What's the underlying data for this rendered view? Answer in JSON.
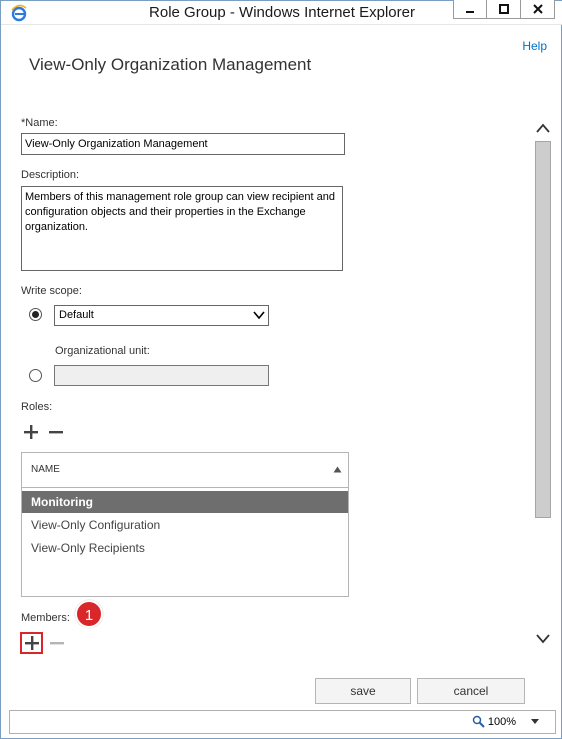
{
  "window": {
    "title": "Role Group - Windows Internet Explorer",
    "controls": [
      "minimize",
      "maximize",
      "close"
    ]
  },
  "help_link": "Help",
  "page_title": "View-Only Organization Management",
  "form": {
    "name_label": "*Name:",
    "name_value": "View-Only Organization Management",
    "description_label": "Description:",
    "description_value": "Members of this management role group can view recipient and configuration objects and their properties in the Exchange organization.",
    "write_scope_label": "Write scope:",
    "write_scope_value": "Default",
    "org_unit_label": "Organizational unit:",
    "org_unit_value": "",
    "roles_label": "Roles:",
    "members_label": "Members:"
  },
  "roles_table": {
    "column_header": "NAME",
    "rows": [
      {
        "name": "Monitoring",
        "selected": true
      },
      {
        "name": "View-Only Configuration",
        "selected": false
      },
      {
        "name": "View-Only Recipients",
        "selected": false
      }
    ]
  },
  "annotation": {
    "badge_number": "1"
  },
  "buttons": {
    "save": "save",
    "cancel": "cancel"
  },
  "statusbar": {
    "zoom": "100%"
  },
  "icons": {
    "app": "ie-logo-icon",
    "add": "plus-icon",
    "remove": "minus-icon",
    "zoom": "magnifier-icon"
  },
  "colors": {
    "accent": "#0072c6",
    "selected_row": "#6e6e6e",
    "callout": "#d9262b"
  }
}
